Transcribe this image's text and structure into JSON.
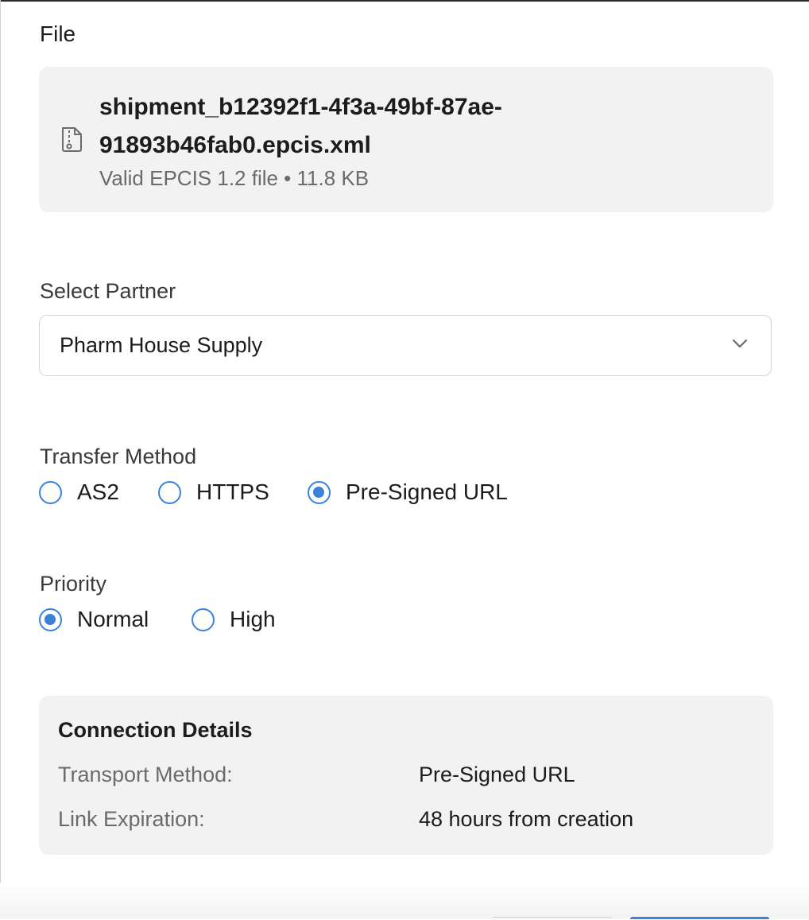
{
  "file_section": {
    "heading": "File",
    "file_name": "shipment_b12392f1-4f3a-49bf-87ae-91893b46fab0.epcis.xml",
    "file_meta": "Valid EPCIS 1.2 file • 11.8 KB",
    "icon": "file-archive-icon"
  },
  "partner": {
    "label": "Select Partner",
    "selected": "Pharm House Supply",
    "icon": "chevron-down-icon"
  },
  "transfer_method": {
    "label": "Transfer Method",
    "options": [
      {
        "label": "AS2",
        "checked": false
      },
      {
        "label": "HTTPS",
        "checked": false
      },
      {
        "label": "Pre-Signed URL",
        "checked": true
      }
    ]
  },
  "priority": {
    "label": "Priority",
    "options": [
      {
        "label": "Normal",
        "checked": true
      },
      {
        "label": "High",
        "checked": false
      }
    ]
  },
  "connection_details": {
    "title": "Connection Details",
    "rows": [
      {
        "key": "Transport Method:",
        "value": "Pre-Signed URL"
      },
      {
        "key": "Link Expiration:",
        "value": "48 hours from creation"
      }
    ]
  },
  "colors": {
    "accent": "#3b82d8",
    "card_bg": "#f2f2f2"
  }
}
